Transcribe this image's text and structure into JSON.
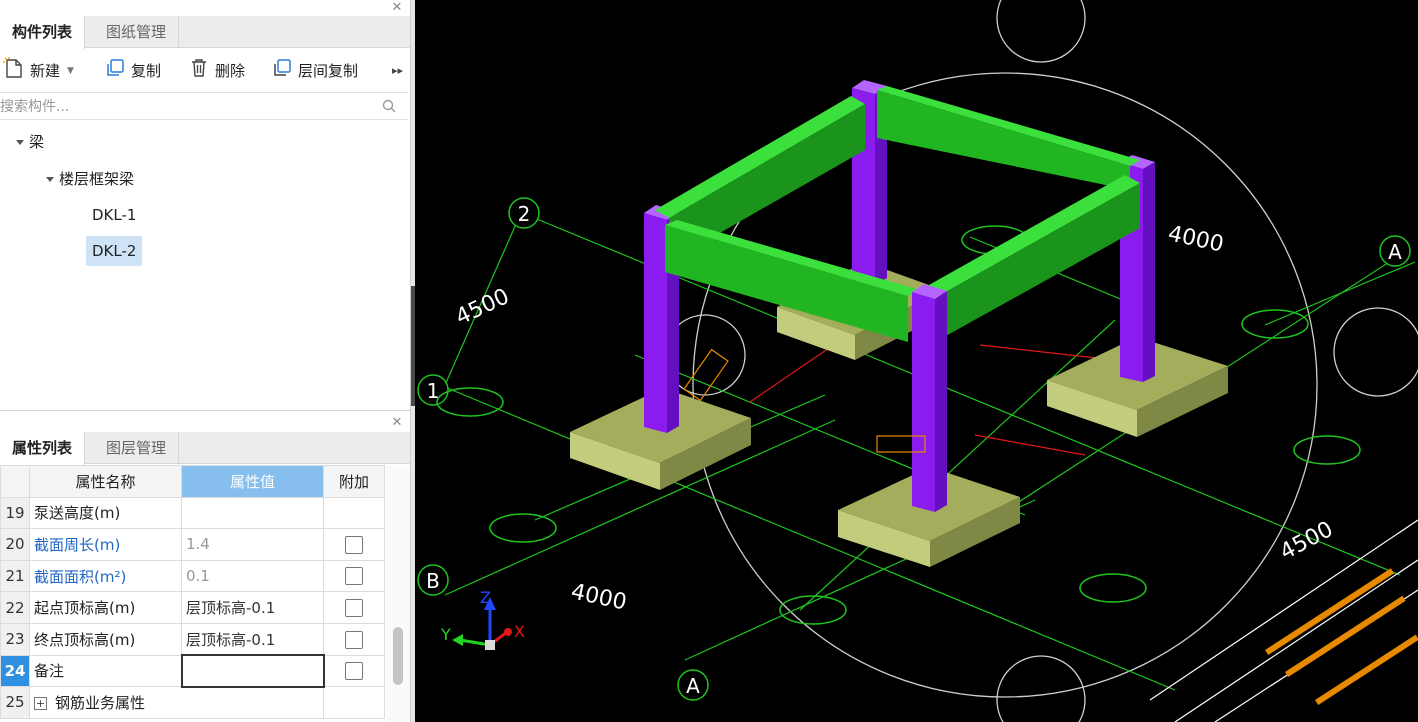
{
  "component_panel": {
    "tabs": [
      {
        "label": "构件列表",
        "active": true
      },
      {
        "label": "图纸管理",
        "active": false
      }
    ],
    "toolbar": {
      "new_label": "新建",
      "copy_label": "复制",
      "delete_label": "删除",
      "floor_copy_label": "层间复制"
    },
    "search": {
      "placeholder": "搜索构件..."
    },
    "tree": {
      "root": "梁",
      "group": "楼层框架梁",
      "items": [
        "DKL-1",
        "DKL-2"
      ],
      "selected": "DKL-2"
    }
  },
  "property_panel": {
    "tabs": [
      {
        "label": "属性列表",
        "active": true
      },
      {
        "label": "图层管理",
        "active": false
      }
    ],
    "columns": {
      "name": "属性名称",
      "value": "属性值",
      "extra": "附加"
    },
    "rows": [
      {
        "num": "19",
        "name": "泵送高度(m)",
        "value": "",
        "blue": false,
        "checkbox": false
      },
      {
        "num": "20",
        "name": "截面周长(m)",
        "value": "1.4",
        "blue": true,
        "checkbox": true
      },
      {
        "num": "21",
        "name": "截面面积(m²)",
        "value": "0.1",
        "blue": true,
        "checkbox": true
      },
      {
        "num": "22",
        "name": "起点顶标高(m)",
        "value": "层顶标高-0.1",
        "blue": false,
        "checkbox": true
      },
      {
        "num": "23",
        "name": "终点顶标高(m)",
        "value": "层顶标高-0.1",
        "blue": false,
        "checkbox": true
      },
      {
        "num": "24",
        "name": "备注",
        "value": "",
        "blue": false,
        "checkbox": true,
        "active": true
      },
      {
        "num": "25",
        "name": "钢筋业务属性",
        "value": "",
        "blue": false,
        "checkbox": false,
        "expandable": true
      }
    ]
  },
  "viewport": {
    "axis_labels": {
      "a": "A",
      "b": "B",
      "one": "1",
      "two": "2"
    },
    "dimensions": {
      "d4500": "4500",
      "d4000": "4000"
    },
    "gizmo": {
      "x": "X",
      "y": "Y",
      "z": "Z"
    },
    "colors": {
      "beam": "#22b522",
      "column": "#8a1cf0",
      "footing": "#a3ad5c",
      "grid": "#1fc41f",
      "axis_circle": "#1fc41f"
    }
  }
}
